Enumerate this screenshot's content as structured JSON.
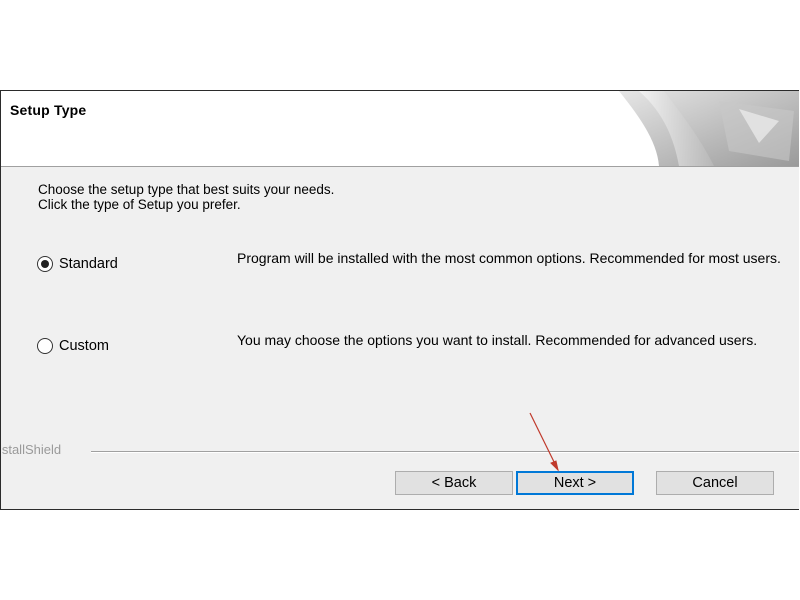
{
  "window": {
    "header_title": "Setup Type"
  },
  "intro": {
    "line1": "Choose the setup type that best suits your needs.",
    "line2": "Click the type of Setup you prefer."
  },
  "options": [
    {
      "label": "Standard",
      "selected": true,
      "description": "Program will be installed with the most common options. Recommended for most users."
    },
    {
      "label": "Custom",
      "selected": false,
      "description": "You may choose the options you want to install. Recommended for advanced users."
    }
  ],
  "footer": {
    "brand": "InstallShield"
  },
  "buttons": {
    "back": "< Back",
    "next": "Next >",
    "cancel": "Cancel"
  },
  "colors": {
    "annotation_arrow": "#c0392b",
    "default_button_border": "#0078d7"
  },
  "icons": {
    "header_graphic": "installshield-page-curl-graphic",
    "annotation": "red-arrow-pointer"
  }
}
